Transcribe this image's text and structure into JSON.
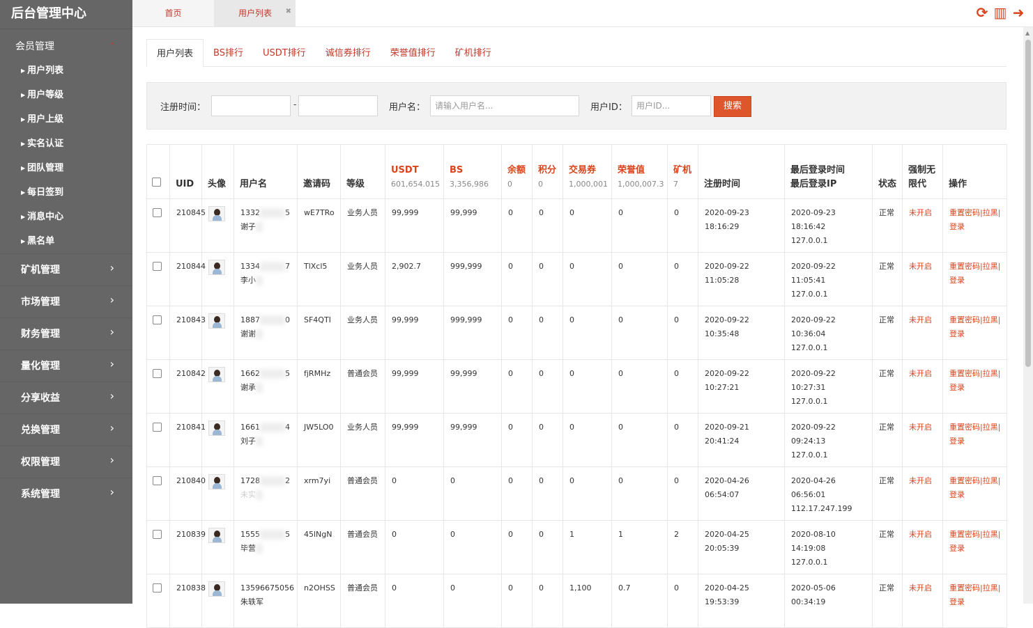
{
  "brand": "后台管理中心",
  "sidebar": {
    "open_menu": {
      "label": "会员管理",
      "items": [
        "用户列表",
        "用户等级",
        "用户上级",
        "实名认证",
        "团队管理",
        "每日签到",
        "消息中心",
        "黑名单"
      ]
    },
    "groups": [
      "矿机管理",
      "市场管理",
      "财务管理",
      "量化管理",
      "分享收益",
      "兑换管理",
      "权限管理",
      "系统管理"
    ]
  },
  "top_tabs": [
    "首页",
    "用户列表"
  ],
  "content_tabs": [
    "用户列表",
    "BS排行",
    "USDT排行",
    "诚信券排行",
    "荣誉值排行",
    "矿机排行"
  ],
  "filter": {
    "reg_time_label": "注册时间：",
    "dash": "-",
    "username_label": "用户名：",
    "username_placeholder": "请输入用户名...",
    "uid_label": "用户ID：",
    "uid_placeholder": "用户ID...",
    "search_button": "搜索"
  },
  "table": {
    "headers": {
      "uid": "UID",
      "avatar": "头像",
      "username": "用户名",
      "invite": "邀请码",
      "level": "等级",
      "usdt": "USDT",
      "bs": "BS",
      "balance": "余额",
      "points": "积分",
      "trade": "交易券",
      "honor": "荣誉值",
      "miner": "矿机",
      "reg_time": "注册时间",
      "last_login_time": "最后登录时间",
      "last_login_ip": "最后登录IP",
      "status": "状态",
      "force": "强制无限代",
      "ops": "操作"
    },
    "sums": {
      "usdt": "601,654.015",
      "bs": "3,356,986",
      "balance": "0",
      "points": "0",
      "trade": "1,000,001",
      "honor": "1,000,007.3",
      "miner": "7"
    },
    "op_labels": {
      "reset": "重置密码|",
      "black": "拉黑|",
      "login": "登录"
    },
    "rows": [
      {
        "uid": "210845",
        "phone_a": "1332",
        "phone_b": "5",
        "name": "谢子",
        "invite": "wE7TRo",
        "level": "业务人员",
        "usdt": "99,999",
        "bs": "99,999",
        "balance": "0",
        "points": "0",
        "trade": "0",
        "honor": "0",
        "miner": "0",
        "reg_date": "2020-09-23",
        "reg_time": "18:16:29",
        "login_date": "2020-09-23",
        "login_time": "18:16:42",
        "ip": "127.0.0.1",
        "status": "正常",
        "force": "未开启"
      },
      {
        "uid": "210844",
        "phone_a": "1334",
        "phone_b": "7",
        "name": "李小",
        "invite": "TlXcl5",
        "level": "业务人员",
        "usdt": "2,902.7",
        "bs": "999,999",
        "balance": "0",
        "points": "0",
        "trade": "0",
        "honor": "0",
        "miner": "0",
        "reg_date": "2020-09-22",
        "reg_time": "11:05:28",
        "login_date": "2020-09-22",
        "login_time": "11:05:41",
        "ip": "127.0.0.1",
        "status": "正常",
        "force": "未开启"
      },
      {
        "uid": "210843",
        "phone_a": "1887",
        "phone_b": "0",
        "name": "谢谢",
        "invite": "SF4QTI",
        "level": "业务人员",
        "usdt": "99,999",
        "bs": "999,999",
        "balance": "0",
        "points": "0",
        "trade": "0",
        "honor": "0",
        "miner": "0",
        "reg_date": "2020-09-22",
        "reg_time": "10:35:48",
        "login_date": "2020-09-22",
        "login_time": "10:36:04",
        "ip": "127.0.0.1",
        "status": "正常",
        "force": "未开启"
      },
      {
        "uid": "210842",
        "phone_a": "1662",
        "phone_b": "5",
        "name": "谢承",
        "invite": "fjRMHz",
        "level": "普通会员",
        "usdt": "99,999",
        "bs": "99,999",
        "balance": "0",
        "points": "0",
        "trade": "0",
        "honor": "0",
        "miner": "0",
        "reg_date": "2020-09-22",
        "reg_time": "10:27:21",
        "login_date": "2020-09-22",
        "login_time": "10:27:31",
        "ip": "127.0.0.1",
        "status": "正常",
        "force": "未开启"
      },
      {
        "uid": "210841",
        "phone_a": "1661",
        "phone_b": "4",
        "name": "刘子",
        "invite": "JW5LO0",
        "level": "业务人员",
        "usdt": "99,999",
        "bs": "99,999",
        "balance": "0",
        "points": "0",
        "trade": "0",
        "honor": "0",
        "miner": "0",
        "reg_date": "2020-09-21",
        "reg_time": "20:41:24",
        "login_date": "2020-09-22",
        "login_time": "09:24:13",
        "ip": "127.0.0.1",
        "status": "正常",
        "force": "未开启"
      },
      {
        "uid": "210840",
        "phone_a": "1728",
        "phone_b": "2",
        "name": "未实",
        "invite": "xrm7yi",
        "level": "普通会员",
        "usdt": "0",
        "bs": "0",
        "balance": "0",
        "points": "0",
        "trade": "0",
        "honor": "0",
        "miner": "0",
        "reg_date": "2020-04-26",
        "reg_time": "06:54:07",
        "login_date": "2020-04-26",
        "login_time": "06:56:01",
        "ip": "112.17.247.199",
        "status": "正常",
        "force": "未开启"
      },
      {
        "uid": "210839",
        "phone_a": "1555",
        "phone_b": "5",
        "name": "毕营",
        "invite": "45lNgN",
        "level": "普通会员",
        "usdt": "0",
        "bs": "0",
        "balance": "0",
        "points": "0",
        "trade": "1",
        "honor": "1",
        "miner": "2",
        "reg_date": "2020-04-25",
        "reg_time": "20:05:39",
        "login_date": "2020-08-10",
        "login_time": "14:19:08",
        "ip": "127.0.0.1",
        "status": "正常",
        "force": "未开启"
      },
      {
        "uid": "210838",
        "phone_a": "13596675056",
        "phone_b": "",
        "name": "朱轶军",
        "invite": "n2OHSS",
        "level": "普通会员",
        "usdt": "0",
        "bs": "0",
        "balance": "0",
        "points": "0",
        "trade": "1,100",
        "honor": "0.7",
        "miner": "0",
        "reg_date": "2020-04-25",
        "reg_time": "19:53:39",
        "login_date": "2020-05-06",
        "login_time": "00:34:19",
        "ip": "",
        "status": "正常",
        "force": "未开启"
      }
    ]
  }
}
